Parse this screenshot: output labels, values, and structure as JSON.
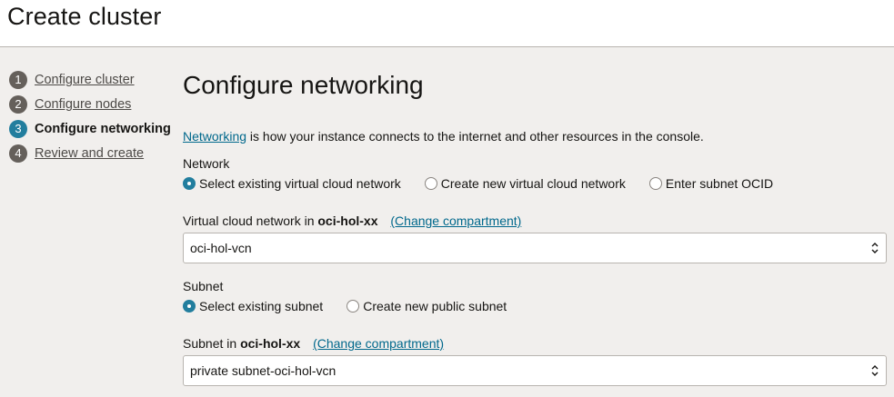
{
  "header": {
    "title": "Create cluster"
  },
  "steps": [
    {
      "number": "1",
      "label": "Configure cluster"
    },
    {
      "number": "2",
      "label": "Configure nodes"
    },
    {
      "number": "3",
      "label": "Configure networking"
    },
    {
      "number": "4",
      "label": "Review and create"
    }
  ],
  "main": {
    "title": "Configure networking",
    "intro_link": "Networking",
    "intro_text": " is how your instance connects to the internet and other resources in the console.",
    "network": {
      "label": "Network",
      "options": [
        "Select existing virtual cloud network",
        "Create new virtual cloud network",
        "Enter subnet OCID"
      ]
    },
    "vcn": {
      "label_prefix": "Virtual cloud network in ",
      "compartment": "oci-hol-xx",
      "change_link": "(Change compartment)",
      "value": "oci-hol-vcn"
    },
    "subnet": {
      "label": "Subnet",
      "options": [
        "Select existing subnet",
        "Create new public subnet"
      ]
    },
    "subnet_select": {
      "label_prefix": "Subnet in ",
      "compartment": "oci-hol-xx",
      "change_link": "(Change compartment)",
      "value": "private subnet-oci-hol-vcn"
    }
  },
  "colors": {
    "accent": "#227e9e",
    "link": "#00688c",
    "background": "#f1efed"
  },
  "icons": {
    "select_chevron": "updown-chevron-icon"
  }
}
